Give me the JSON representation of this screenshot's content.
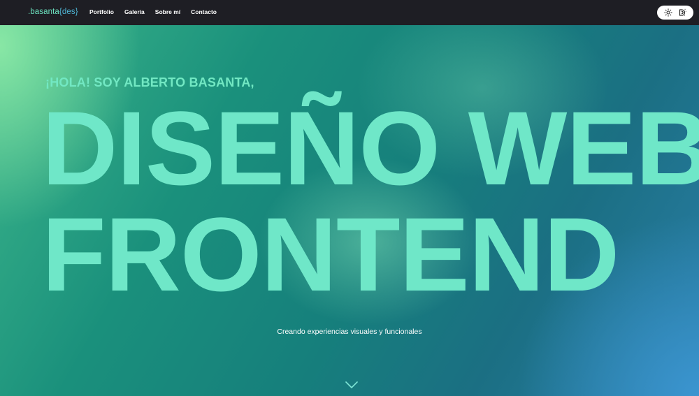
{
  "header": {
    "logo": {
      "prefix": ".basanta",
      "open_brace": "{",
      "suffix": "des",
      "close_brace": "}"
    },
    "nav_items": [
      {
        "label": "Portfolio"
      },
      {
        "label": "Galería"
      },
      {
        "label": "Sobre mí"
      },
      {
        "label": "Contacto"
      }
    ],
    "theme_toggle": {
      "light_icon": "sun-icon",
      "dark_icon": "moon-stars-icon"
    }
  },
  "hero": {
    "greeting": "¡HOLA! SOY ALBERTO BASANTA,",
    "headline_line1": "DISEÑO WEB",
    "headline_line2": "FRONTEND",
    "tagline": "Creando experiencias visuales y funcionales",
    "scroll_icon": "chevron-down-icon"
  },
  "colors": {
    "navbar_bg": "#1e1e24",
    "accent": "#6fe7c8",
    "logo_brace": "#4fb6d6",
    "text_light": "#ffffff"
  }
}
